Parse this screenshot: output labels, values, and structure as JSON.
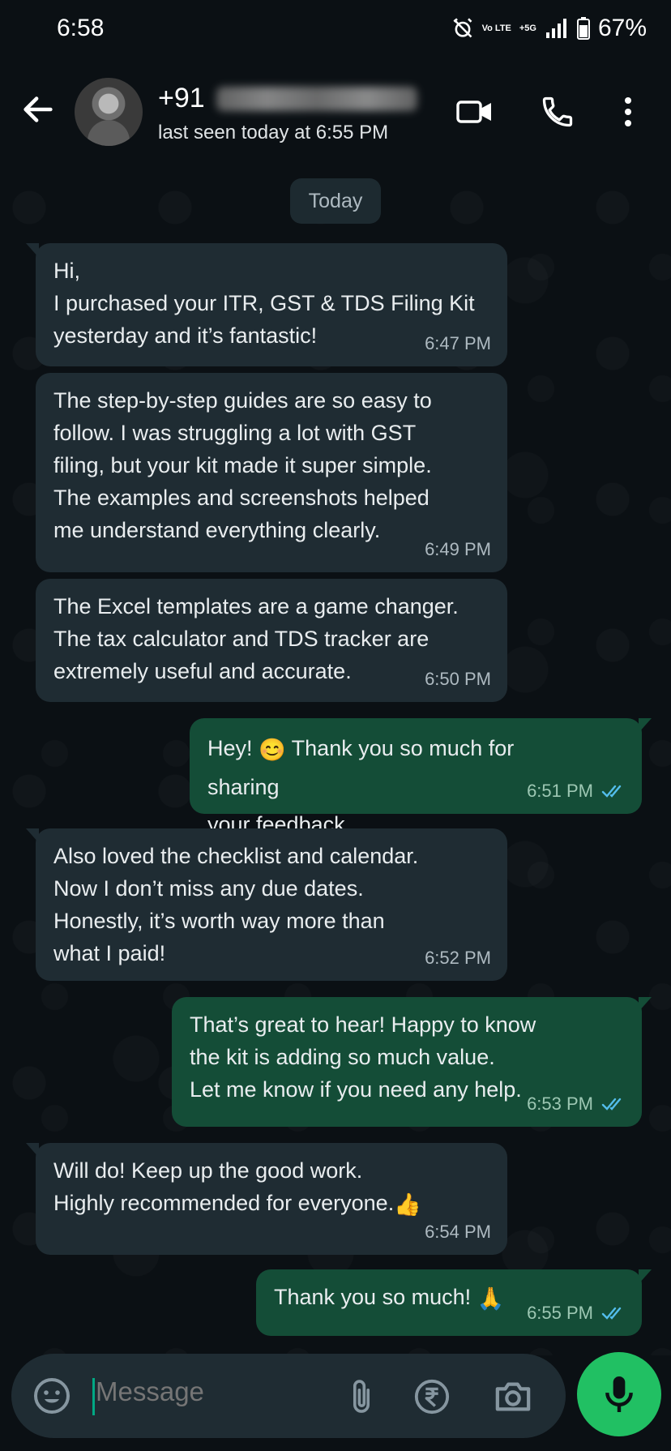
{
  "status_bar": {
    "time": "6:58",
    "network": "Vo LTE",
    "network2": "+5G",
    "battery_pct": "67%"
  },
  "header": {
    "contact_prefix": "+91",
    "last_seen": "last seen today at 6:55 PM"
  },
  "chat": {
    "date_chip": "Today",
    "messages": [
      {
        "direction": "incoming",
        "text": "Hi,\nI purchased your ITR, GST & TDS Filing Kit\nyesterday and it’s fantastic!",
        "time": "6:47 PM"
      },
      {
        "direction": "incoming",
        "text": "The step-by-step guides are so easy to\nfollow. I was struggling a lot with GST\nfiling, but your kit made it super simple.\nThe examples and screenshots helped\nme understand everything clearly.",
        "time": "6:49 PM"
      },
      {
        "direction": "incoming",
        "text": "The Excel templates are a game changer.\nThe tax calculator and TDS tracker are\nextremely useful and accurate.",
        "time": "6:50 PM"
      },
      {
        "direction": "outgoing",
        "text_a": "Hey! ",
        "emoji": "😊",
        "text_b": " Thank you so much for sharing\nyour feedback.",
        "time": "6:51 PM",
        "status": "read"
      },
      {
        "direction": "incoming",
        "text": "Also loved the checklist and calendar.\nNow I don’t miss any due dates.\nHonestly, it’s worth way more than\nwhat I paid!",
        "time": "6:52 PM"
      },
      {
        "direction": "outgoing",
        "text": "That’s great to hear! Happy to know\nthe kit is adding so much value.\nLet me know if you need any help.",
        "time": "6:53 PM",
        "status": "read"
      },
      {
        "direction": "incoming",
        "text": "Will do! Keep up the good work.\nHighly recommended for everyone.",
        "emoji": "👍",
        "time": "6:54 PM"
      },
      {
        "direction": "outgoing",
        "text": "Thank you so much! ",
        "emoji": "🙏",
        "time": "6:55 PM",
        "status": "read"
      }
    ]
  },
  "composer": {
    "placeholder": "Message"
  },
  "colors": {
    "incoming_bubble": "#1f2c33",
    "outgoing_bubble": "#144d37",
    "read_ticks": "#53bdeb",
    "accent": "#21c063"
  }
}
